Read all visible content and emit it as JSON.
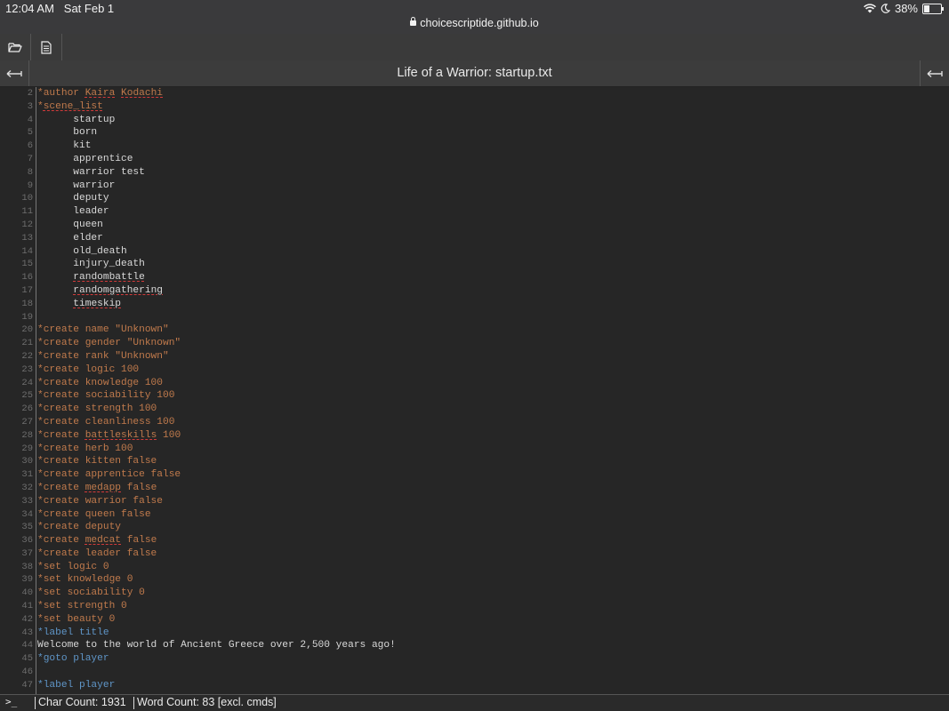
{
  "status_bar": {
    "time": "12:04 AM",
    "date": "Sat Feb 1",
    "url": "choicescriptide.github.io",
    "battery": "38%",
    "battery_level": 0.38,
    "icons": [
      "wifi-icon",
      "moon-icon",
      "battery-icon",
      "lock-icon"
    ]
  },
  "toolbar": {
    "icons": [
      "folder-open-icon",
      "document-icon"
    ]
  },
  "editor": {
    "title": "Life of a Warrior: startup.txt",
    "lines": [
      {
        "n": "2",
        "text": "*author Kaira Kodachi",
        "style": "cmd",
        "spell": [
          "Kaira",
          "Kodachi"
        ]
      },
      {
        "n": "3",
        "text": "*scene_list",
        "style": "cmd",
        "spell": [
          "scene_list"
        ]
      },
      {
        "n": "4",
        "text": "      startup",
        "style": "txt"
      },
      {
        "n": "5",
        "text": "      born",
        "style": "txt"
      },
      {
        "n": "6",
        "text": "      kit",
        "style": "txt"
      },
      {
        "n": "7",
        "text": "      apprentice",
        "style": "txt"
      },
      {
        "n": "8",
        "text": "      warrior test",
        "style": "txt"
      },
      {
        "n": "9",
        "text": "      warrior",
        "style": "txt"
      },
      {
        "n": "10",
        "text": "      deputy",
        "style": "txt"
      },
      {
        "n": "11",
        "text": "      leader",
        "style": "txt"
      },
      {
        "n": "12",
        "text": "      queen",
        "style": "txt"
      },
      {
        "n": "13",
        "text": "      elder",
        "style": "txt"
      },
      {
        "n": "14",
        "text": "      old_death",
        "style": "txt"
      },
      {
        "n": "15",
        "text": "      injury_death",
        "style": "txt"
      },
      {
        "n": "16",
        "text": "      randombattle",
        "style": "txt",
        "spell": [
          "randombattle"
        ]
      },
      {
        "n": "17",
        "text": "      randomgathering",
        "style": "txt",
        "spell": [
          "randomgathering"
        ]
      },
      {
        "n": "18",
        "text": "      timeskip",
        "style": "txt",
        "spell": [
          "timeskip"
        ]
      },
      {
        "n": "19",
        "text": "",
        "style": "txt"
      },
      {
        "n": "20",
        "text": "*create name \"Unknown\"",
        "style": "cmd"
      },
      {
        "n": "21",
        "text": "*create gender \"Unknown\"",
        "style": "cmd"
      },
      {
        "n": "22",
        "text": "*create rank \"Unknown\"",
        "style": "cmd"
      },
      {
        "n": "23",
        "text": "*create logic 100",
        "style": "cmd"
      },
      {
        "n": "24",
        "text": "*create knowledge 100",
        "style": "cmd"
      },
      {
        "n": "25",
        "text": "*create sociability 100",
        "style": "cmd"
      },
      {
        "n": "26",
        "text": "*create strength 100",
        "style": "cmd"
      },
      {
        "n": "27",
        "text": "*create cleanliness 100",
        "style": "cmd"
      },
      {
        "n": "28",
        "text": "*create battleskills 100",
        "style": "cmd",
        "spell": [
          "battleskills"
        ]
      },
      {
        "n": "29",
        "text": "*create herb 100",
        "style": "cmd"
      },
      {
        "n": "30",
        "text": "*create kitten false",
        "style": "cmd"
      },
      {
        "n": "31",
        "text": "*create apprentice false",
        "style": "cmd"
      },
      {
        "n": "32",
        "text": "*create medapp false",
        "style": "cmd",
        "spell": [
          "medapp"
        ]
      },
      {
        "n": "33",
        "text": "*create warrior false",
        "style": "cmd"
      },
      {
        "n": "34",
        "text": "*create queen false",
        "style": "cmd"
      },
      {
        "n": "35",
        "text": "*create deputy",
        "style": "cmd"
      },
      {
        "n": "36",
        "text": "*create medcat false",
        "style": "cmd",
        "spell": [
          "medcat"
        ]
      },
      {
        "n": "37",
        "text": "*create leader false",
        "style": "cmd"
      },
      {
        "n": "38",
        "text": "*set logic 0",
        "style": "cmd"
      },
      {
        "n": "39",
        "text": "*set knowledge 0",
        "style": "cmd"
      },
      {
        "n": "40",
        "text": "*set sociability 0",
        "style": "cmd"
      },
      {
        "n": "41",
        "text": "*set strength 0",
        "style": "cmd"
      },
      {
        "n": "42",
        "text": "*set beauty 0",
        "style": "cmd"
      },
      {
        "n": "43",
        "text": "*label title",
        "style": "lbl"
      },
      {
        "n": "44",
        "text": "Welcome to the world of Ancient Greece over 2,500 years ago!",
        "style": "txt"
      },
      {
        "n": "45",
        "text": "*goto player",
        "style": "lbl"
      },
      {
        "n": "46",
        "text": "",
        "style": "txt"
      },
      {
        "n": "47",
        "text": "*label player",
        "style": "lbl"
      }
    ]
  },
  "footer": {
    "prompt": ">_",
    "char_count": "Char Count: 1931",
    "word_count": "Word Count: 83 [excl. cmds]"
  },
  "colors": {
    "command": "#c07a4c",
    "label": "#5f95c7",
    "text": "#d9d9d9",
    "spellcheck": "#d23a3a"
  }
}
